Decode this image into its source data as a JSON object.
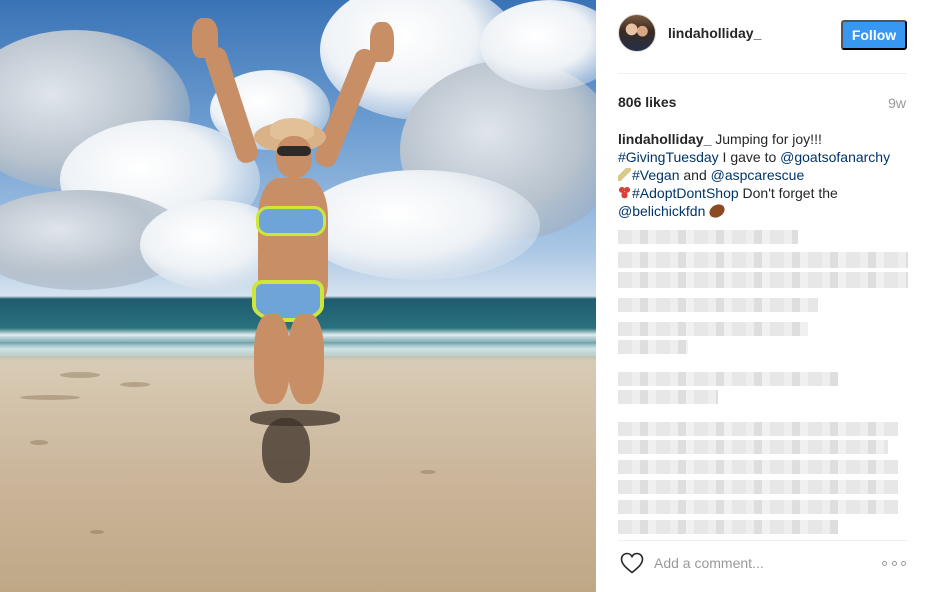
{
  "post": {
    "image_alt": "",
    "header": {
      "username": "lindaholliday_",
      "follow_label": "Follow"
    },
    "stats": {
      "likes": "806 likes",
      "age": "9w"
    },
    "caption": {
      "username": "lindaholliday_",
      "text_1": " Jumping for joy!!!",
      "tag_giving": "#GivingTuesday",
      "text_2": " I gave to ",
      "mention_goats": "@goatsofanarchy",
      "tag_vegan": "#Vegan",
      "text_3": " and ",
      "mention_asp": "@aspcarescue",
      "tag_adopt": "#AdoptDontShop",
      "text_4": " Don't forget the",
      "mention_belichick": "@belichickfdn"
    },
    "comment_box": {
      "placeholder": "Add a comment..."
    },
    "icons": [
      "heart-icon",
      "more-options-icon",
      "cocktail-emoji-icon",
      "paw-emoji-icon",
      "football-emoji-icon"
    ],
    "colors": {
      "follow_bg": "#3897f0",
      "link": "#003569",
      "muted": "#999999"
    }
  }
}
